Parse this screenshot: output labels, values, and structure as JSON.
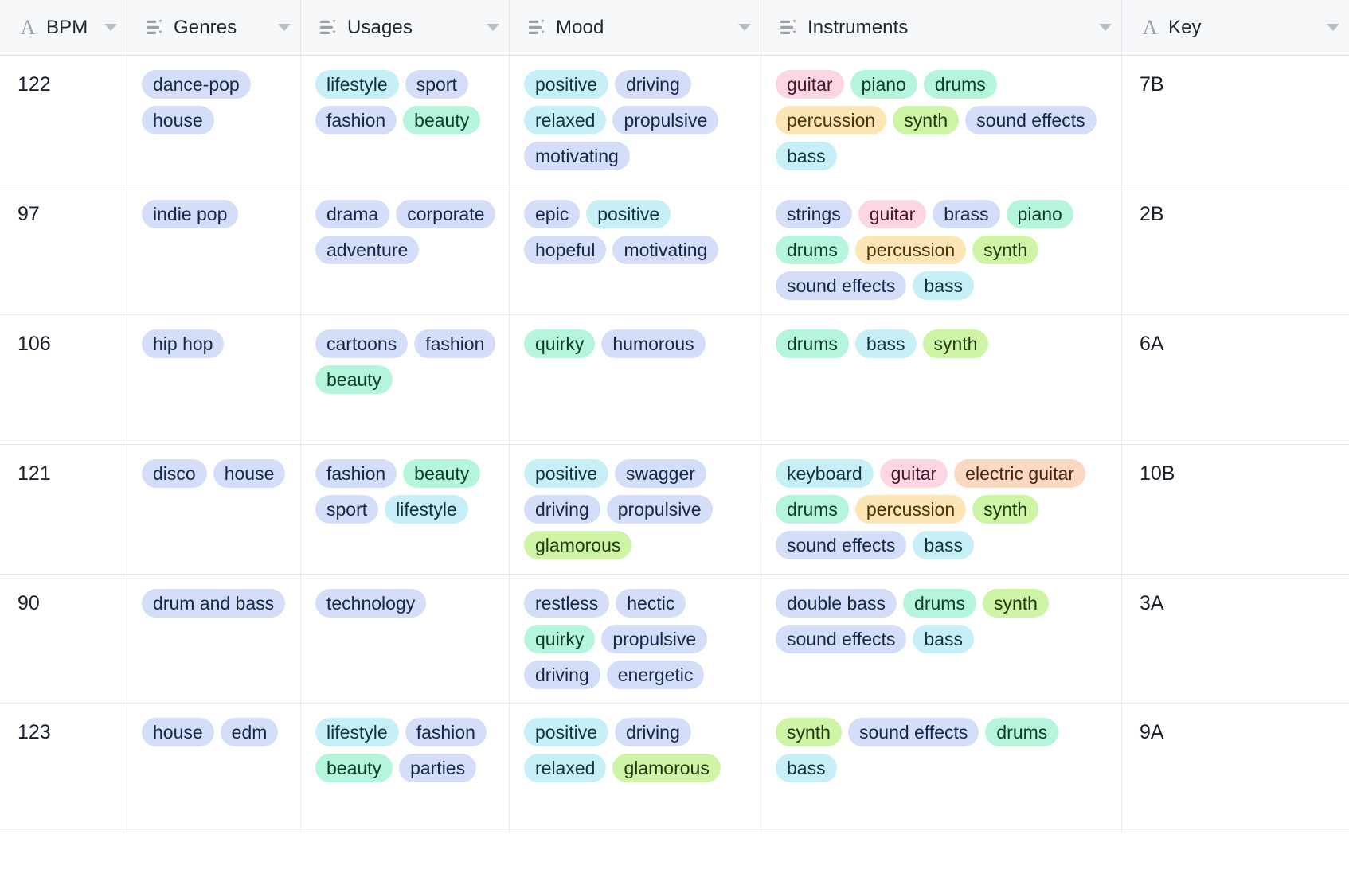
{
  "table": {
    "columns": [
      {
        "label": "BPM",
        "icon": "text-type-icon",
        "icon_glyph": "A",
        "has_caret": true
      },
      {
        "label": "Genres",
        "icon": "multi-select-icon",
        "icon_glyph": "",
        "has_caret": true
      },
      {
        "label": "Usages",
        "icon": "multi-select-icon",
        "icon_glyph": "",
        "has_caret": true
      },
      {
        "label": "Mood",
        "icon": "multi-select-icon",
        "icon_glyph": "",
        "has_caret": true
      },
      {
        "label": "Instruments",
        "icon": "multi-select-icon",
        "icon_glyph": "",
        "has_caret": true
      },
      {
        "label": "Key",
        "icon": "text-type-icon",
        "icon_glyph": "A",
        "has_caret": true
      }
    ],
    "rows": [
      {
        "bpm": "122",
        "genres": [
          {
            "text": "dance-pop",
            "color": "p-blue"
          },
          {
            "text": "house",
            "color": "p-blue"
          }
        ],
        "usages": [
          {
            "text": "lifestyle",
            "color": "p-cyan"
          },
          {
            "text": "sport",
            "color": "p-blue"
          },
          {
            "text": "fashion",
            "color": "p-blue"
          },
          {
            "text": "beauty",
            "color": "p-mint"
          }
        ],
        "mood": [
          {
            "text": "positive",
            "color": "p-cyan"
          },
          {
            "text": "driving",
            "color": "p-blue"
          },
          {
            "text": "relaxed",
            "color": "p-cyan"
          },
          {
            "text": "propulsive",
            "color": "p-blue"
          },
          {
            "text": "motivating",
            "color": "p-blue"
          }
        ],
        "instruments": [
          {
            "text": "guitar",
            "color": "p-pink"
          },
          {
            "text": "piano",
            "color": "p-mint"
          },
          {
            "text": "drums",
            "color": "p-mint"
          },
          {
            "text": "percussion",
            "color": "p-amber"
          },
          {
            "text": "synth",
            "color": "p-green"
          },
          {
            "text": "sound effects",
            "color": "p-blue"
          },
          {
            "text": "bass",
            "color": "p-cyan"
          }
        ],
        "key": "7B"
      },
      {
        "bpm": "97",
        "genres": [
          {
            "text": "indie pop",
            "color": "p-blue"
          }
        ],
        "usages": [
          {
            "text": "drama",
            "color": "p-blue"
          },
          {
            "text": "corporate",
            "color": "p-blue"
          },
          {
            "text": "adventure",
            "color": "p-blue"
          }
        ],
        "mood": [
          {
            "text": "epic",
            "color": "p-blue"
          },
          {
            "text": "positive",
            "color": "p-cyan"
          },
          {
            "text": "hopeful",
            "color": "p-blue"
          },
          {
            "text": "motivating",
            "color": "p-blue"
          }
        ],
        "instruments": [
          {
            "text": "strings",
            "color": "p-blue"
          },
          {
            "text": "guitar",
            "color": "p-pink"
          },
          {
            "text": "brass",
            "color": "p-blue"
          },
          {
            "text": "piano",
            "color": "p-mint"
          },
          {
            "text": "drums",
            "color": "p-mint"
          },
          {
            "text": "percussion",
            "color": "p-amber"
          },
          {
            "text": "synth",
            "color": "p-green"
          },
          {
            "text": "sound effects",
            "color": "p-blue"
          },
          {
            "text": "bass",
            "color": "p-cyan"
          }
        ],
        "key": "2B"
      },
      {
        "bpm": "106",
        "genres": [
          {
            "text": "hip hop",
            "color": "p-blue"
          }
        ],
        "usages": [
          {
            "text": "cartoons",
            "color": "p-blue"
          },
          {
            "text": "fashion",
            "color": "p-blue"
          },
          {
            "text": "beauty",
            "color": "p-mint"
          }
        ],
        "mood": [
          {
            "text": "quirky",
            "color": "p-mint"
          },
          {
            "text": "humorous",
            "color": "p-blue"
          }
        ],
        "instruments": [
          {
            "text": "drums",
            "color": "p-mint"
          },
          {
            "text": "bass",
            "color": "p-cyan"
          },
          {
            "text": "synth",
            "color": "p-green"
          }
        ],
        "key": "6A"
      },
      {
        "bpm": "121",
        "genres": [
          {
            "text": "disco",
            "color": "p-blue"
          },
          {
            "text": "house",
            "color": "p-blue"
          }
        ],
        "usages": [
          {
            "text": "fashion",
            "color": "p-blue"
          },
          {
            "text": "beauty",
            "color": "p-mint"
          },
          {
            "text": "sport",
            "color": "p-blue"
          },
          {
            "text": "lifestyle",
            "color": "p-cyan"
          }
        ],
        "mood": [
          {
            "text": "positive",
            "color": "p-cyan"
          },
          {
            "text": "swagger",
            "color": "p-blue"
          },
          {
            "text": "driving",
            "color": "p-blue"
          },
          {
            "text": "propulsive",
            "color": "p-blue"
          },
          {
            "text": "glamorous",
            "color": "p-green"
          }
        ],
        "instruments": [
          {
            "text": "keyboard",
            "color": "p-cyan"
          },
          {
            "text": "guitar",
            "color": "p-pink"
          },
          {
            "text": "electric guitar",
            "color": "p-peach"
          },
          {
            "text": "drums",
            "color": "p-mint"
          },
          {
            "text": "percussion",
            "color": "p-amber"
          },
          {
            "text": "synth",
            "color": "p-green"
          },
          {
            "text": "sound effects",
            "color": "p-blue"
          },
          {
            "text": "bass",
            "color": "p-cyan"
          }
        ],
        "key": "10B"
      },
      {
        "bpm": "90",
        "genres": [
          {
            "text": "drum and bass",
            "color": "p-blue"
          }
        ],
        "usages": [
          {
            "text": "technology",
            "color": "p-blue"
          }
        ],
        "mood": [
          {
            "text": "restless",
            "color": "p-blue"
          },
          {
            "text": "hectic",
            "color": "p-blue"
          },
          {
            "text": "quirky",
            "color": "p-mint"
          },
          {
            "text": "propulsive",
            "color": "p-blue"
          },
          {
            "text": "driving",
            "color": "p-blue"
          },
          {
            "text": "energetic",
            "color": "p-blue"
          }
        ],
        "instruments": [
          {
            "text": "double bass",
            "color": "p-blue"
          },
          {
            "text": "drums",
            "color": "p-mint"
          },
          {
            "text": "synth",
            "color": "p-green"
          },
          {
            "text": "sound effects",
            "color": "p-blue"
          },
          {
            "text": "bass",
            "color": "p-cyan"
          }
        ],
        "key": "3A"
      },
      {
        "bpm": "123",
        "genres": [
          {
            "text": "house",
            "color": "p-blue"
          },
          {
            "text": "edm",
            "color": "p-blue"
          }
        ],
        "usages": [
          {
            "text": "lifestyle",
            "color": "p-cyan"
          },
          {
            "text": "fashion",
            "color": "p-blue"
          },
          {
            "text": "beauty",
            "color": "p-mint"
          },
          {
            "text": "parties",
            "color": "p-blue"
          }
        ],
        "mood": [
          {
            "text": "positive",
            "color": "p-cyan"
          },
          {
            "text": "driving",
            "color": "p-blue"
          },
          {
            "text": "relaxed",
            "color": "p-cyan"
          },
          {
            "text": "glamorous",
            "color": "p-green"
          }
        ],
        "instruments": [
          {
            "text": "synth",
            "color": "p-green"
          },
          {
            "text": "sound effects",
            "color": "p-blue"
          },
          {
            "text": "drums",
            "color": "p-mint"
          },
          {
            "text": "bass",
            "color": "p-cyan"
          }
        ],
        "key": "9A"
      }
    ]
  },
  "colors": {
    "pill_blue": "#d5def9",
    "pill_cyan": "#c7f0f6",
    "pill_mint": "#b4f5dc",
    "pill_green": "#cef5a6",
    "pill_pink": "#fcd6e2",
    "pill_amber": "#fde6b5",
    "pill_peach": "#fbd8c2",
    "header_bg": "#f7f8f9",
    "grid_line": "#e4e6e9"
  }
}
